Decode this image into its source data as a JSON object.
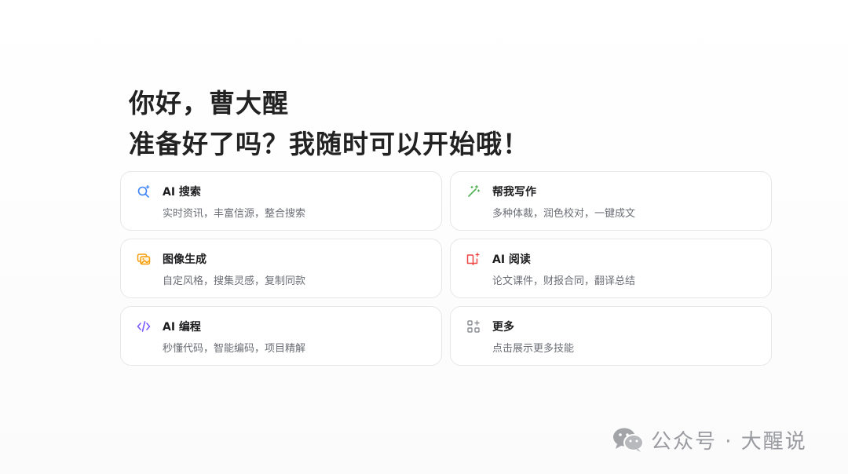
{
  "greeting": {
    "line1": "你好，曹大醒",
    "line2": "准备好了吗？我随时可以开始哦！"
  },
  "cards": [
    {
      "icon": "search-sparkle-icon",
      "title": "AI 搜索",
      "desc": "实时资讯，丰富信源，整合搜索",
      "color": "#3b82f6"
    },
    {
      "icon": "magic-wand-icon",
      "title": "帮我写作",
      "desc": "多种体裁，润色校对，一键成文",
      "color": "#4caf50"
    },
    {
      "icon": "image-gallery-icon",
      "title": "图像生成",
      "desc": "自定风格，搜集灵感，复制同款",
      "color": "#f59e0b"
    },
    {
      "icon": "book-sparkle-icon",
      "title": "AI 阅读",
      "desc": "论文课件，财报合同，翻译总结",
      "color": "#ef4444"
    },
    {
      "icon": "code-icon",
      "title": "AI 编程",
      "desc": "秒懂代码，智能编码，项目精解",
      "color": "#7c5cff"
    },
    {
      "icon": "grid-plus-icon",
      "title": "更多",
      "desc": "点击展示更多技能",
      "color": "#8a8d93"
    }
  ],
  "watermark": {
    "text": "公众号 · 大醒说",
    "icon": "wechat-icon"
  }
}
